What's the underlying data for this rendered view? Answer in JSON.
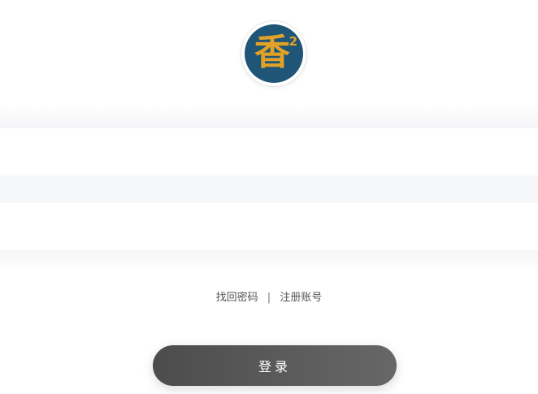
{
  "logo": {
    "char": "香",
    "superscript": "2",
    "colors": {
      "background": "#1f5677",
      "glyph": "#e3a226"
    }
  },
  "form": {
    "account_field": {
      "value": "",
      "placeholder": ""
    },
    "password_field": {
      "value": "",
      "placeholder": ""
    }
  },
  "links": {
    "recover_password": "找回密码",
    "separator": "|",
    "register": "注册账号"
  },
  "login_button": {
    "label": "登录"
  }
}
